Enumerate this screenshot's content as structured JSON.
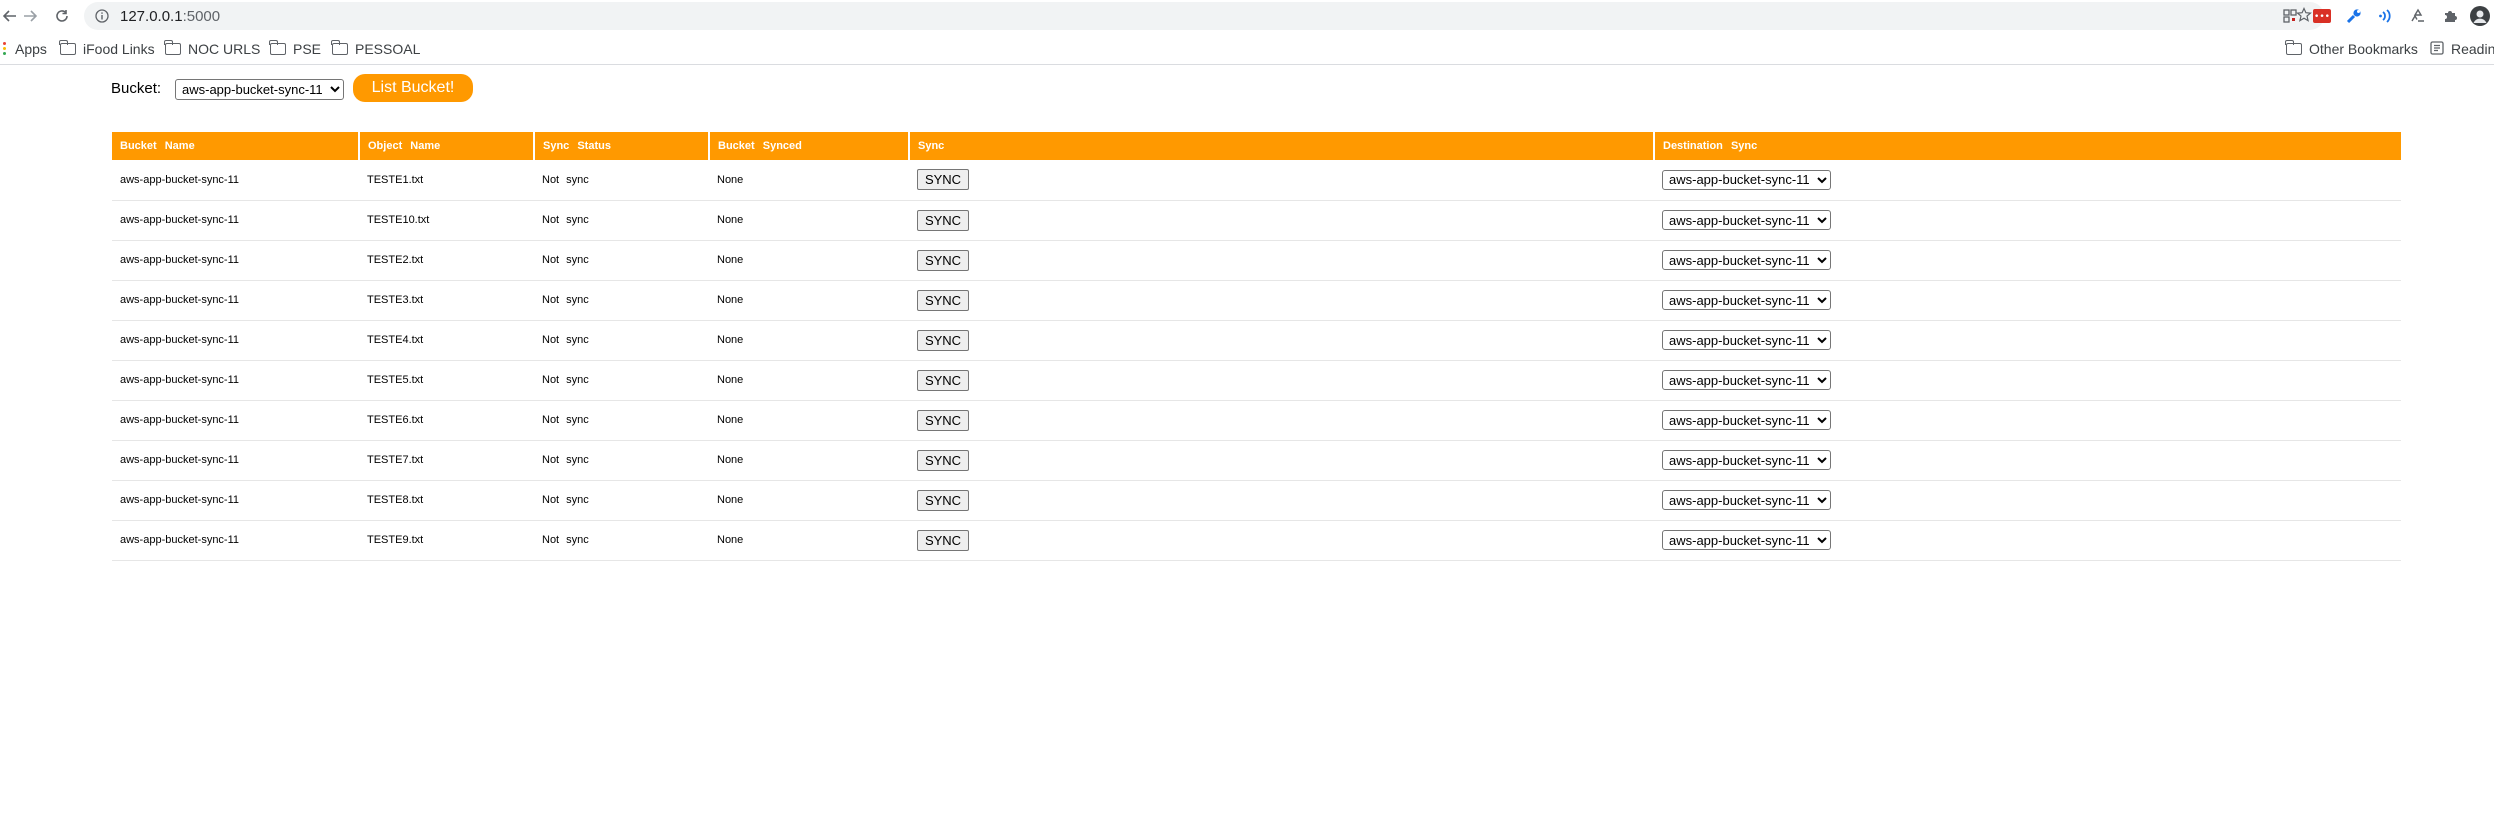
{
  "browser": {
    "url_host": "127.0.0.1",
    "url_port": ":5000",
    "bookmarks": [
      "Apps",
      "iFood Links",
      "NOC URLS",
      "PSE",
      "PESSOAL"
    ],
    "other_bookmarks": "Other Bookmarks",
    "reading_list": "Readin"
  },
  "bucket_picker": {
    "label": "Bucket:",
    "selected": "aws-app-bucket-sync-11",
    "button": "List Bucket!"
  },
  "table": {
    "headers": [
      "Bucket Name",
      "Object Name",
      "Sync Status",
      "Bucket Synced",
      "Sync",
      "Destination Sync"
    ],
    "sync_button_label": "SYNC",
    "destination_selected": "aws-app-bucket-sync-11",
    "rows": [
      {
        "bucket": "aws-app-bucket-sync-11",
        "object": "TESTE1.txt",
        "status": "Not sync",
        "synced": "None"
      },
      {
        "bucket": "aws-app-bucket-sync-11",
        "object": "TESTE10.txt",
        "status": "Not sync",
        "synced": "None"
      },
      {
        "bucket": "aws-app-bucket-sync-11",
        "object": "TESTE2.txt",
        "status": "Not sync",
        "synced": "None"
      },
      {
        "bucket": "aws-app-bucket-sync-11",
        "object": "TESTE3.txt",
        "status": "Not sync",
        "synced": "None"
      },
      {
        "bucket": "aws-app-bucket-sync-11",
        "object": "TESTE4.txt",
        "status": "Not sync",
        "synced": "None"
      },
      {
        "bucket": "aws-app-bucket-sync-11",
        "object": "TESTE5.txt",
        "status": "Not sync",
        "synced": "None"
      },
      {
        "bucket": "aws-app-bucket-sync-11",
        "object": "TESTE6.txt",
        "status": "Not sync",
        "synced": "None"
      },
      {
        "bucket": "aws-app-bucket-sync-11",
        "object": "TESTE7.txt",
        "status": "Not sync",
        "synced": "None"
      },
      {
        "bucket": "aws-app-bucket-sync-11",
        "object": "TESTE8.txt",
        "status": "Not sync",
        "synced": "None"
      },
      {
        "bucket": "aws-app-bucket-sync-11",
        "object": "TESTE9.txt",
        "status": "Not sync",
        "synced": "None"
      }
    ]
  },
  "colors": {
    "accent": "#ff9900",
    "header_text": "#ffffff"
  },
  "icons": [
    "back-icon",
    "forward-icon",
    "reload-icon",
    "info-icon",
    "star-icon",
    "extension-icons",
    "folder-icon",
    "reading-list-icon"
  ]
}
